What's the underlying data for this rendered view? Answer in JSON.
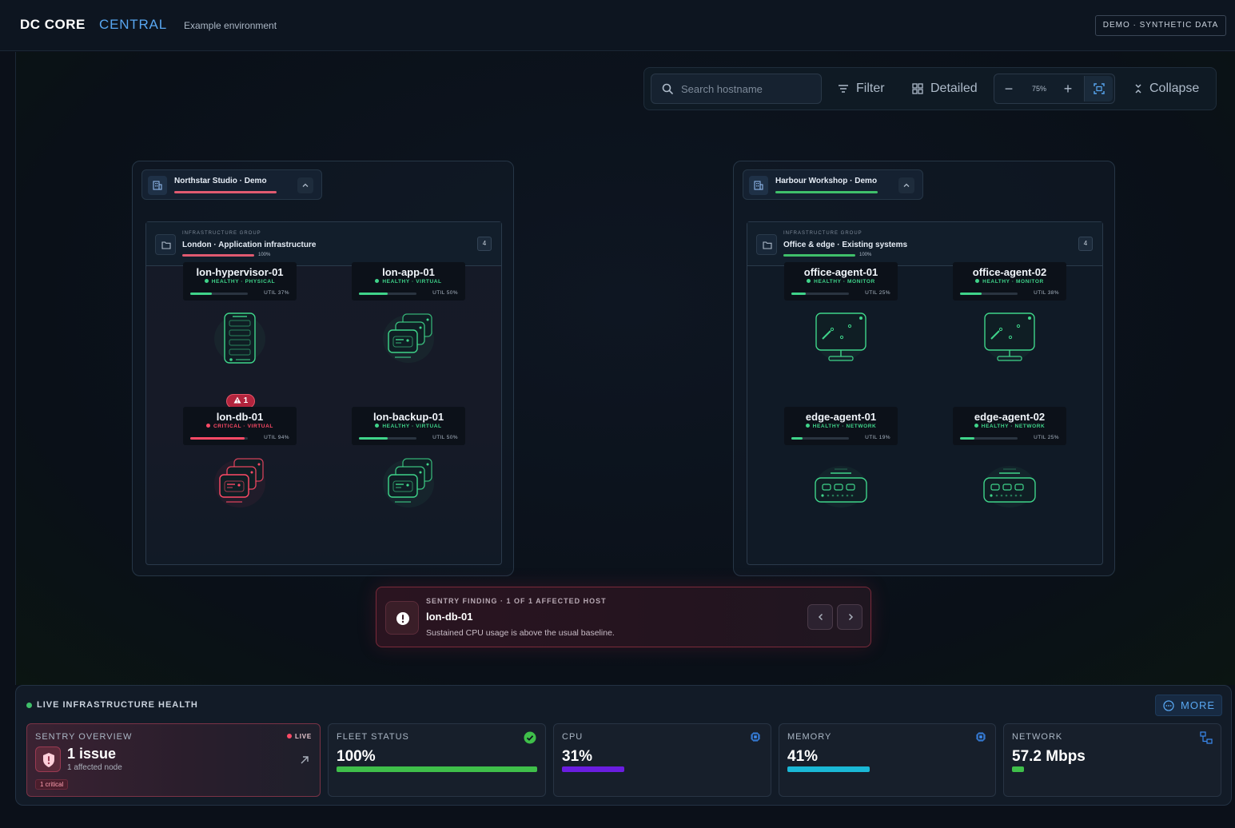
{
  "header": {
    "brand": "DC CORE",
    "brand_accent": "CENTRAL",
    "environment": "Example environment",
    "badge": "DEMO · SYNTHETIC DATA"
  },
  "toolbar": {
    "search_placeholder": "Search hostname",
    "filter_label": "Filter",
    "view_label": "Detailed",
    "zoom_level": "75%",
    "zoom_out": "−",
    "zoom_in": "+",
    "collapse_label": "Collapse"
  },
  "sites": [
    {
      "name": "Northstar Studio · Demo",
      "bar_color": "#e05a70",
      "group": {
        "tag": "INFRASTRUCTURE GROUP",
        "name": "London · Application infrastructure",
        "pct": "100%",
        "count": "4",
        "bar_color": "#e05a70"
      },
      "nodes": [
        {
          "name": "lon-hypervisor-01",
          "status": "HEALTHY · PHYSICAL",
          "util": "UTIL 37%",
          "util_value": 0.37,
          "state": "healthy",
          "icon": "server-icon"
        },
        {
          "name": "lon-app-01",
          "status": "HEALTHY · VIRTUAL",
          "util": "UTIL 50%",
          "util_value": 0.5,
          "state": "healthy",
          "icon": "vm-stack-icon"
        },
        {
          "name": "lon-db-01",
          "status": "CRITICAL · VIRTUAL",
          "util": "UTIL 94%",
          "util_value": 0.94,
          "state": "critical",
          "icon": "vm-stack-icon",
          "alert": "1"
        },
        {
          "name": "lon-backup-01",
          "status": "HEALTHY · VIRTUAL",
          "util": "UTIL 50%",
          "util_value": 0.5,
          "state": "healthy",
          "icon": "vm-stack-icon"
        }
      ]
    },
    {
      "name": "Harbour Workshop · Demo",
      "bar_color": "#3fbf6a",
      "group": {
        "tag": "INFRASTRUCTURE GROUP",
        "name": "Office & edge · Existing systems",
        "pct": "100%",
        "count": "4",
        "bar_color": "#3fbf6a"
      },
      "nodes": [
        {
          "name": "office-agent-01",
          "status": "HEALTHY · MONITOR",
          "util": "UTIL 25%",
          "util_value": 0.25,
          "state": "healthy",
          "icon": "monitor-icon"
        },
        {
          "name": "office-agent-02",
          "status": "HEALTHY · MONITOR",
          "util": "UTIL 38%",
          "util_value": 0.38,
          "state": "healthy",
          "icon": "monitor-icon"
        },
        {
          "name": "edge-agent-01",
          "status": "HEALTHY · NETWORK",
          "util": "UTIL 19%",
          "util_value": 0.19,
          "state": "healthy",
          "icon": "switch-icon"
        },
        {
          "name": "edge-agent-02",
          "status": "HEALTHY · NETWORK",
          "util": "UTIL 25%",
          "util_value": 0.25,
          "state": "healthy",
          "icon": "switch-icon"
        }
      ]
    }
  ],
  "finding": {
    "tag": "SENTRY FINDING · 1 OF 1 AFFECTED HOST",
    "host": "lon-db-01",
    "message": "Sustained CPU usage is above the usual baseline."
  },
  "health": {
    "title": "LIVE INFRASTRUCTURE HEALTH",
    "more_label": "MORE",
    "sentry": {
      "label": "SENTRY OVERVIEW",
      "live": "LIVE",
      "count": "1 issue",
      "sub": "1 affected node",
      "badge": "1 critical"
    },
    "fleet": {
      "label": "FLEET STATUS",
      "value": "100%",
      "level": 1.0,
      "color": "#3fbf4a"
    },
    "cpu": {
      "label": "CPU",
      "value": "31%",
      "level": 0.31,
      "color": "#6a1de0"
    },
    "memory": {
      "label": "MEMORY",
      "value": "41%",
      "level": 0.41,
      "color": "#1ab8d6"
    },
    "network": {
      "label": "NETWORK",
      "value": "57.2 Mbps",
      "level": 0.06,
      "color": "#3fbf4a"
    }
  },
  "colors": {
    "healthy": "#3fd48a",
    "critical": "#ff4a66",
    "accent": "#58a6f0"
  }
}
